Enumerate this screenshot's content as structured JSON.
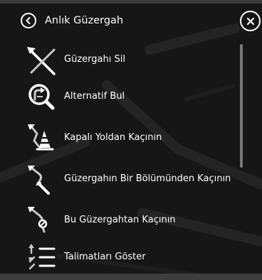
{
  "header": {
    "back_icon": "chevron-left-icon",
    "title": "Anlık Güzergah",
    "close_icon": "close-icon"
  },
  "colors": {
    "background": "#161616",
    "text": "#ffffff",
    "icon_gray": "#c8c8c8",
    "scrollbar": "#777777"
  },
  "menu": {
    "items": [
      {
        "label": "Güzergahı Sil",
        "icon": "delete-route-icon"
      },
      {
        "label": "Alternatif Bul",
        "icon": "find-alternative-icon"
      },
      {
        "label": "Kapalı Yoldan Kaçının",
        "icon": "avoid-blocked-road-icon"
      },
      {
        "label": "Güzergahın Bir Bölümünden Kaçının",
        "icon": "avoid-part-of-route-icon"
      },
      {
        "label": "Bu Güzergahtan Kaçının",
        "icon": "avoid-this-route-icon"
      },
      {
        "label": "Talimatları Göster",
        "icon": "show-instructions-icon"
      }
    ]
  }
}
